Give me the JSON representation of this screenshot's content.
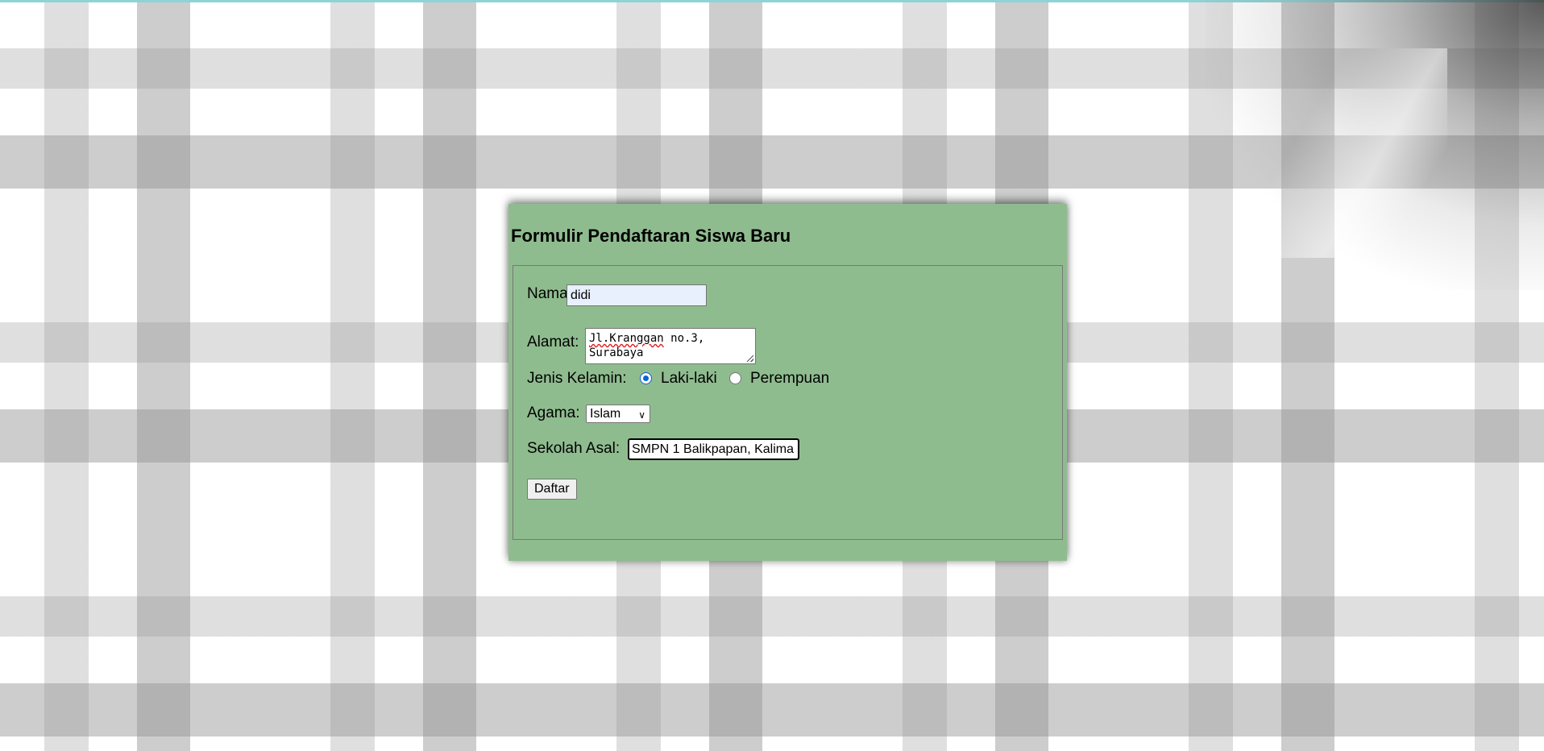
{
  "colors": {
    "card_background": "#8fbc8f",
    "radio_accent": "#0b63d6"
  },
  "form": {
    "title": "Formulir Pendaftaran Siswa Baru",
    "nama": {
      "label": "Nama:",
      "value": "didi"
    },
    "alamat": {
      "label": "Alamat:",
      "value_line1_word": "Jl.Kranggan",
      "value_line1_rest": " no.3,",
      "value_line2": "Surabaya"
    },
    "jenis_kelamin": {
      "label": "Jenis Kelamin:",
      "options": [
        {
          "label": "Laki-laki",
          "checked": true
        },
        {
          "label": "Perempuan",
          "checked": false
        }
      ]
    },
    "agama": {
      "label": "Agama:",
      "selected": "Islam"
    },
    "sekolah_asal": {
      "label": "Sekolah Asal:",
      "value": "SMPN 1 Balikpapan, Kalima"
    },
    "submit_label": "Daftar"
  }
}
